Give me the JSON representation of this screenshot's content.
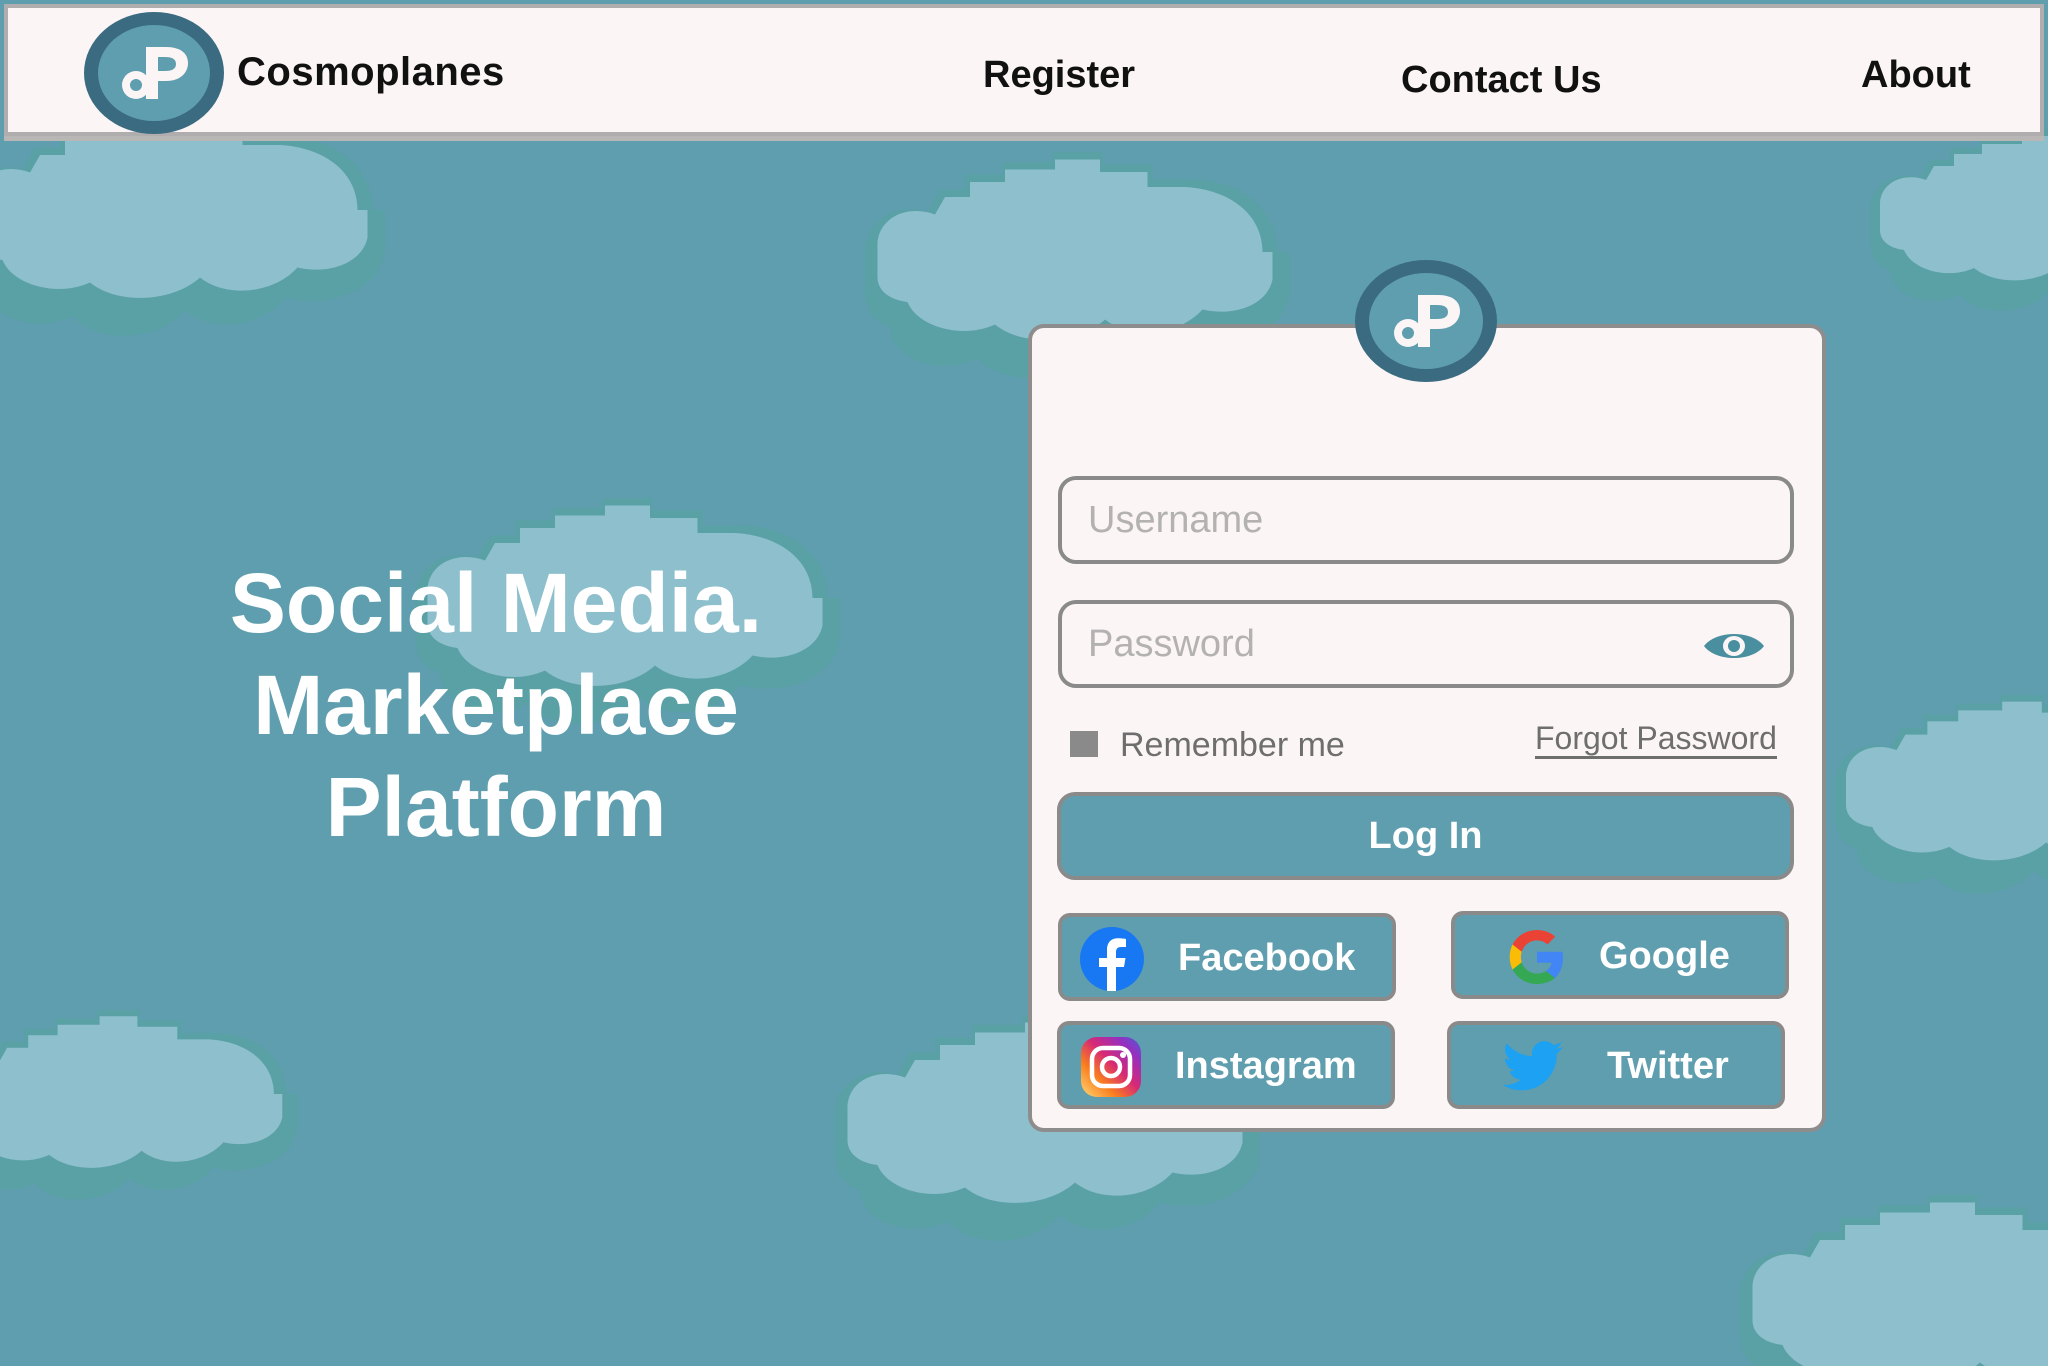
{
  "brand": {
    "name": "Cosmoplanes",
    "logo_icon": "cp-monogram-logo"
  },
  "nav": {
    "items": [
      {
        "label": "Register"
      },
      {
        "label": "Contact Us"
      },
      {
        "label": "About"
      }
    ]
  },
  "hero": {
    "lines": [
      "Social Media.",
      "Marketplace",
      "Platform"
    ]
  },
  "login": {
    "username_placeholder": "Username",
    "password_placeholder": "Password",
    "show_password_icon": "eye-icon",
    "remember_label": "Remember me",
    "forgot_label": "Forgot Password",
    "submit_label": "Log In",
    "social": [
      {
        "label": "Facebook",
        "icon": "facebook-icon"
      },
      {
        "label": "Google",
        "icon": "google-icon"
      },
      {
        "label": "Instagram",
        "icon": "instagram-icon"
      },
      {
        "label": "Twitter",
        "icon": "twitter-icon"
      }
    ]
  },
  "colors": {
    "background": "#5f9eae",
    "cloud": "#8dbfcd",
    "cloud_shadow": "#5aa1a6",
    "panel": "#fbf5f6",
    "logo_dark": "#3a6b80",
    "border": "#8b8a8a"
  }
}
